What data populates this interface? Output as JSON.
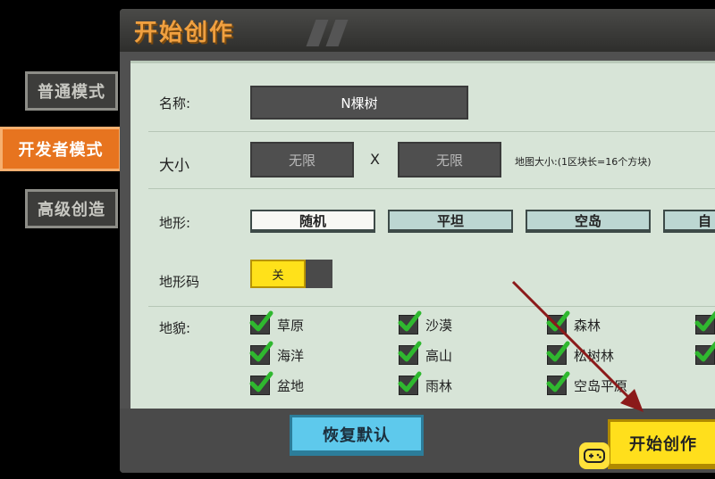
{
  "window": {
    "title": "开始创作"
  },
  "sidebar": {
    "items": [
      {
        "label": "普通模式",
        "active": false
      },
      {
        "label": "开发者模式",
        "active": true
      },
      {
        "label": "高级创造",
        "active": false
      }
    ]
  },
  "form": {
    "name": {
      "label": "名称:",
      "value": "N棵树"
    },
    "size": {
      "label": "大小",
      "width": "无限",
      "separator": "X",
      "height": "无限",
      "note": "地图大小:(1区块长=16个方块)"
    },
    "terrain": {
      "label": "地形:",
      "options": [
        "随机",
        "平坦",
        "空岛",
        "自"
      ],
      "selected": "随机"
    },
    "terrain_code": {
      "label": "地形码",
      "toggle_label": "关"
    },
    "landform": {
      "label": "地貌:",
      "items": [
        {
          "label": "草原",
          "checked": true
        },
        {
          "label": "沙漠",
          "checked": true
        },
        {
          "label": "森林",
          "checked": true
        },
        {
          "label": "",
          "checked": true
        },
        {
          "label": "海洋",
          "checked": true
        },
        {
          "label": "高山",
          "checked": true
        },
        {
          "label": "松树林",
          "checked": true
        },
        {
          "label": "",
          "checked": true
        },
        {
          "label": "盆地",
          "checked": true
        },
        {
          "label": "雨林",
          "checked": true
        },
        {
          "label": "空岛平原",
          "checked": true
        }
      ]
    }
  },
  "footer": {
    "restore_label": "恢复默认",
    "start_label": "开始创作"
  },
  "colors": {
    "accent": "#e7741f",
    "title": "#f0a040",
    "highlight": "#ffdf1c",
    "check": "#2fb82f",
    "arrow": "#8b1a1a"
  }
}
